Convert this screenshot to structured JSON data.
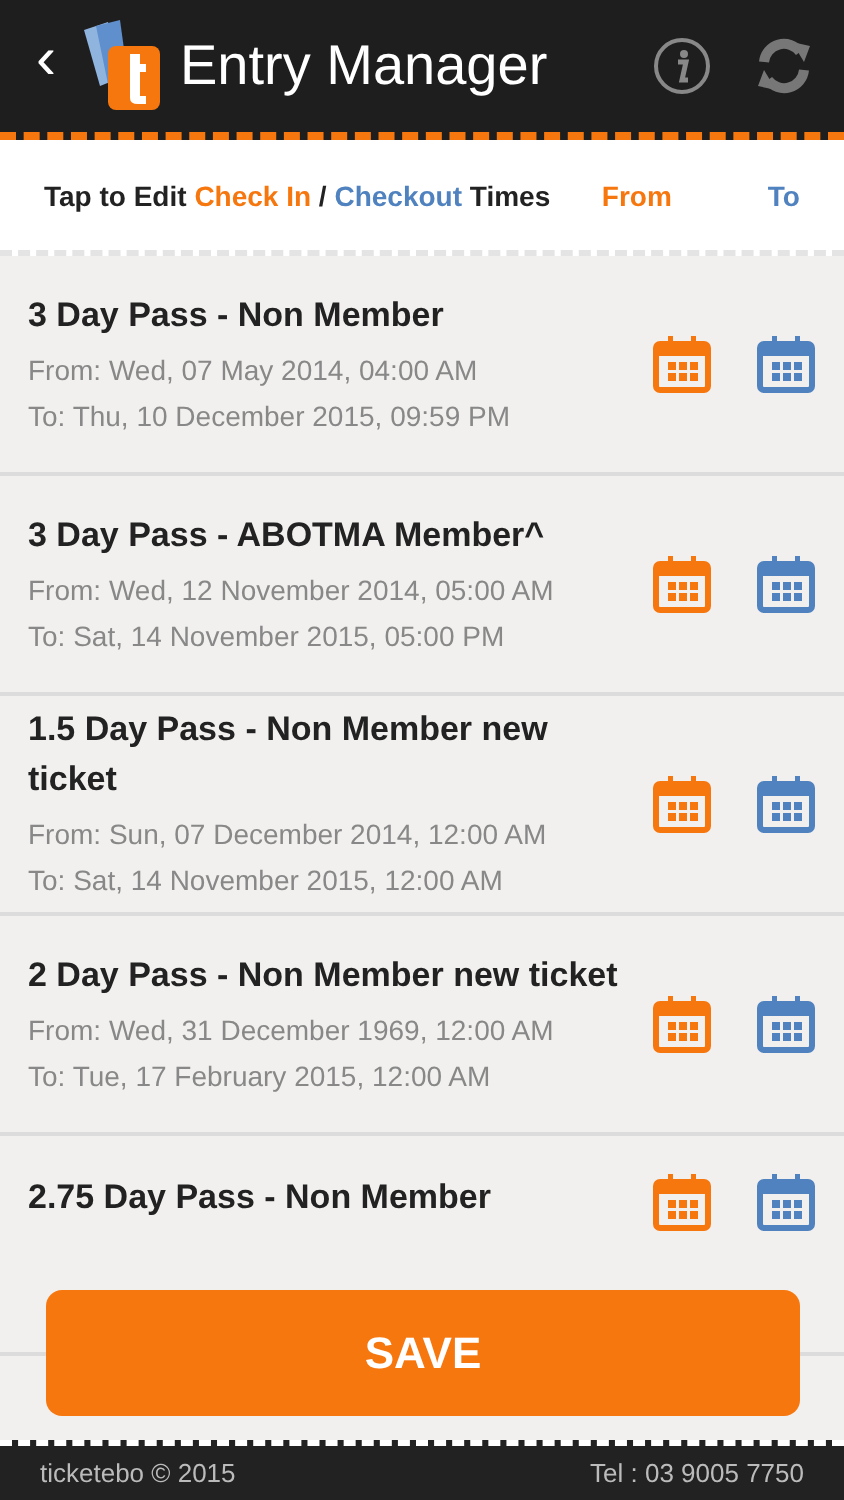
{
  "header": {
    "back": "‹",
    "title": "Entry Manager"
  },
  "instructions": {
    "parts": [
      {
        "text": "Tap to Edit ",
        "kind": "plain"
      },
      {
        "text": "Check In",
        "kind": "checkin"
      },
      {
        "text": " / ",
        "kind": "plain"
      },
      {
        "text": "Checkout",
        "kind": "checkout"
      },
      {
        "text": " Times",
        "kind": "plain"
      }
    ],
    "from_label": "From",
    "to_label": "To"
  },
  "entries": [
    {
      "title": "3 Day Pass - Non Member",
      "from": "From: Wed, 07 May 2014, 04:00 AM",
      "to": "To: Thu, 10 December 2015, 09:59 PM"
    },
    {
      "title": "3 Day Pass - ABOTMA Member^",
      "from": "From: Wed, 12 November 2014, 05:00 AM",
      "to": "To: Sat, 14 November 2015, 05:00 PM"
    },
    {
      "title": "1.5 Day Pass - Non Member new ticket",
      "from": "From: Sun, 07 December 2014, 12:00 AM",
      "to": "To: Sat, 14 November 2015, 12:00 AM"
    },
    {
      "title": "2 Day Pass - Non Member new ticket",
      "from": "From: Wed, 31 December 1969, 12:00 AM",
      "to": "To: Tue, 17 February 2015, 12:00 AM"
    },
    {
      "title": "2.75 Day Pass - Non Member"
    }
  ],
  "save_button": "SAVE",
  "footer": {
    "brand": "ticketebo © 2015",
    "phone": "Tel : 03 9005 7750"
  }
}
